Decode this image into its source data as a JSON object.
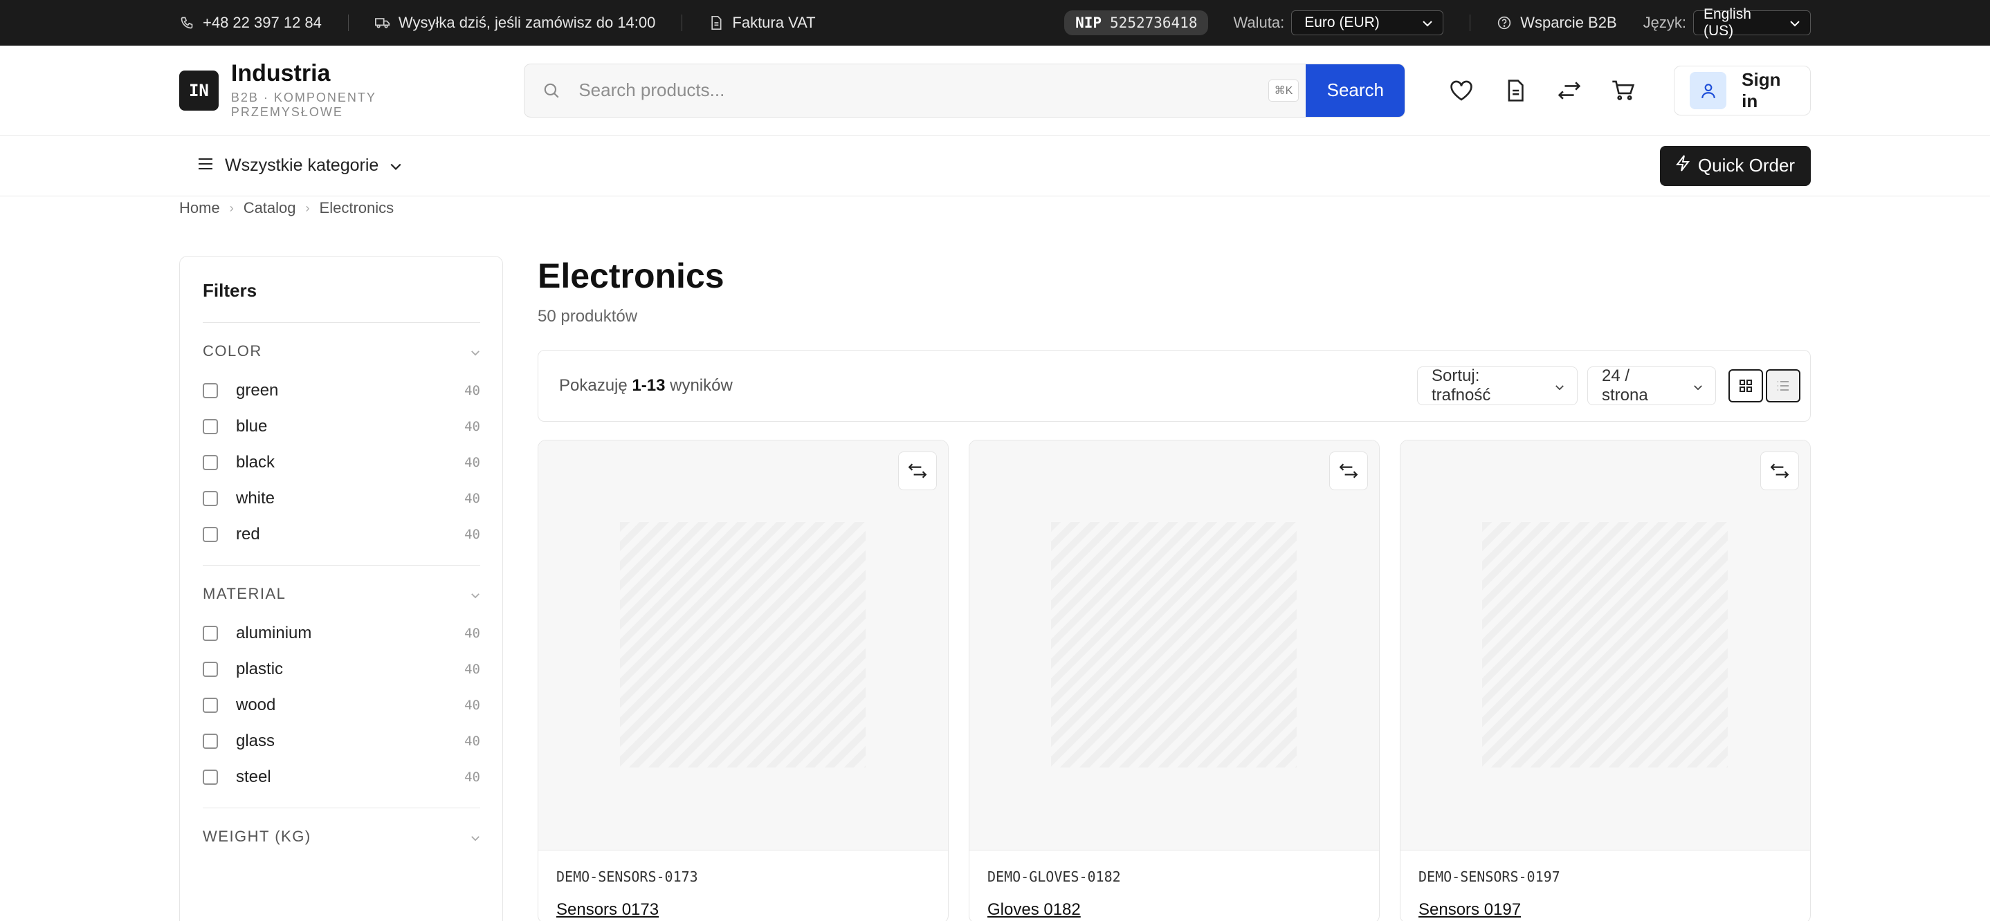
{
  "topbar": {
    "phone": "+48 22 397 12 84",
    "shipping": "Wysyłka dziś, jeśli zamówisz do 14:00",
    "invoice": "Faktura VAT",
    "nip_label": "NIP",
    "nip_value": "5252736418",
    "currency_label": "Waluta:",
    "currency_value": "Euro (EUR)",
    "support": "Wsparcie B2B",
    "language_label": "Język:",
    "language_value": "English (US)"
  },
  "header": {
    "logo_mark": "IN",
    "logo_name": "Industria",
    "logo_sub": "B2B · KOMPONENTY PRZEMYSŁOWE",
    "search_placeholder": "Search products...",
    "search_shortcut": "⌘K",
    "search_button": "Search",
    "signin": "Sign in"
  },
  "nav": {
    "all_categories": "Wszystkie kategorie",
    "quick_order": "Quick Order"
  },
  "breadcrumb": [
    "Home",
    "Catalog",
    "Electronics"
  ],
  "sidebar": {
    "title": "Filters",
    "groups": [
      {
        "title": "COLOR",
        "options": [
          {
            "label": "green",
            "count": "40"
          },
          {
            "label": "blue",
            "count": "40"
          },
          {
            "label": "black",
            "count": "40"
          },
          {
            "label": "white",
            "count": "40"
          },
          {
            "label": "red",
            "count": "40"
          }
        ]
      },
      {
        "title": "MATERIAL",
        "options": [
          {
            "label": "aluminium",
            "count": "40"
          },
          {
            "label": "plastic",
            "count": "40"
          },
          {
            "label": "wood",
            "count": "40"
          },
          {
            "label": "glass",
            "count": "40"
          },
          {
            "label": "steel",
            "count": "40"
          }
        ]
      },
      {
        "title": "WEIGHT (KG)",
        "options": []
      }
    ]
  },
  "content": {
    "title": "Electronics",
    "count": "50 produktów",
    "showing_prefix": "Pokazuję",
    "showing_range": "1-13",
    "showing_suffix": "wyników",
    "sort": "Sortuj: trafność",
    "per_page": "24 / strona"
  },
  "products": [
    {
      "sku": "DEMO-SENSORS-0173",
      "name": "Sensors 0173"
    },
    {
      "sku": "DEMO-GLOVES-0182",
      "name": "Gloves 0182"
    },
    {
      "sku": "DEMO-SENSORS-0197",
      "name": "Sensors 0197"
    }
  ],
  "colors": {
    "topbar_bg": "#1b1b1b",
    "accent": "#1d4ed8",
    "avatar_bg": "#dbeafe"
  }
}
